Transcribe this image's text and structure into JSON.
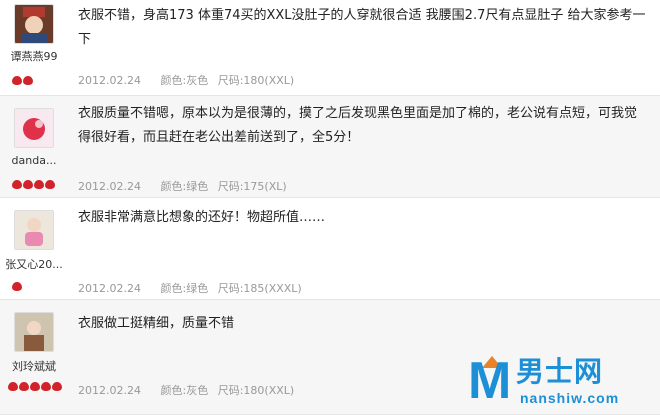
{
  "reviews": [
    {
      "username": "谭燕燕99",
      "content": "衣服不错，身高173 体重74买的XXL没肚子的人穿就很合适  我腰围2.7尺有点显肚子  给大家参考一下",
      "date": "2012.02.24",
      "color": "颜色:灰色",
      "size": "尺码:180(XXL)",
      "hearts_red": 2
    },
    {
      "username": "danda...",
      "content": "衣服质量不错嗯，原本以为是很薄的，摸了之后发现黑色里面是加了棉的，老公说有点短，可我觉得很好看，而且赶在老公出差前送到了，全5分！",
      "date": "2012.02.24",
      "color": "颜色:绿色",
      "size": "尺码:175(XL)",
      "hearts_red": 4
    },
    {
      "username": "张又心20...",
      "content": "衣服非常满意比想象的还好！物超所值……",
      "date": "2012.02.24",
      "color": "颜色:绿色",
      "size": "尺码:185(XXXL)",
      "hearts_red": 1
    },
    {
      "username": "刘玲斌斌",
      "content": "衣服做工挺精细，质量不错",
      "date": "2012.02.24",
      "color": "颜色:灰色",
      "size": "尺码:180(XXL)",
      "hearts_red": 5
    }
  ],
  "watermark": {
    "letter": "M",
    "chinese": "男士网",
    "domain": "nanshiw.com"
  },
  "colors": {
    "heart": "#d0232a",
    "meta_text": "#999999",
    "alt_row": "#f6f6f6",
    "logo": "#1d8fd6"
  }
}
